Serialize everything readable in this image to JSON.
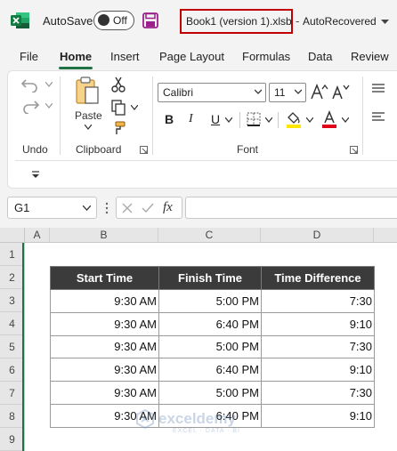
{
  "titlebar": {
    "autosave_label": "AutoSave",
    "autosave_state": "Off",
    "file_name": "Book1 (version 1).xlsb",
    "separator": "-",
    "status": "AutoRecovered"
  },
  "tabs": [
    "File",
    "Home",
    "Insert",
    "Page Layout",
    "Formulas",
    "Data",
    "Review"
  ],
  "active_tab": "Home",
  "ribbon": {
    "undo_label": "Undo",
    "clipboard_label": "Clipboard",
    "paste_label": "Paste",
    "font_label": "Font",
    "font_name": "Calibri",
    "font_size": "11",
    "bold": "B",
    "italic": "I",
    "underline": "U"
  },
  "formula_bar": {
    "name_box": "G1",
    "fx": "fx",
    "formula": ""
  },
  "grid": {
    "columns": [
      "A",
      "B",
      "C",
      "D"
    ],
    "rows": [
      "1",
      "2",
      "3",
      "4",
      "5",
      "6",
      "7",
      "8",
      "9"
    ]
  },
  "table": {
    "headers": [
      "Start Time",
      "Finish Time",
      "Time Difference"
    ],
    "rows": [
      [
        "9:30 AM",
        "5:00 PM",
        "7:30"
      ],
      [
        "9:30 AM",
        "6:40 PM",
        "9:10"
      ],
      [
        "9:30 AM",
        "5:00 PM",
        "7:30"
      ],
      [
        "9:30 AM",
        "6:40 PM",
        "9:10"
      ],
      [
        "9:30 AM",
        "5:00 PM",
        "7:30"
      ],
      [
        "9:30 AM",
        "6:40 PM",
        "9:10"
      ]
    ]
  },
  "watermark": {
    "name": "exceldemy",
    "tagline": "EXCEL · DATA · BI"
  },
  "colors": {
    "excel_green": "#217346",
    "header_fill": "#3b3b3b",
    "highlight_box": "#c00000",
    "font_color_red": "#e0001b",
    "highlight_yellow": "#ffe600"
  }
}
